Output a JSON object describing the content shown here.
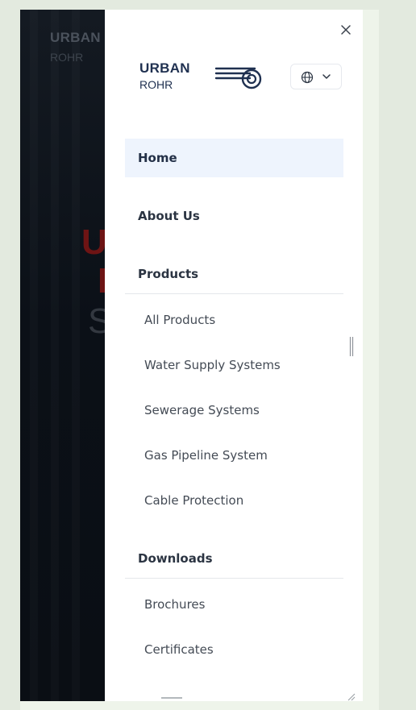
{
  "background": {
    "brand_name": "URBAN",
    "brand_sub": "ROHR",
    "hero_line1": "U",
    "hero_line2": "I",
    "hero_line3": "S"
  },
  "drawer": {
    "close_icon": "close-icon",
    "logo": {
      "line1": "URBAN",
      "line2": "ROHR",
      "mark_icon": "pipe-logo-icon"
    },
    "language_button": {
      "icon": "globe-icon",
      "dropdown_icon": "chevron-down-icon"
    },
    "nav": {
      "home": "Home",
      "about": "About Us",
      "products": {
        "label": "Products",
        "items": [
          "All Products",
          "Water Supply Systems",
          "Sewerage Systems",
          "Gas Pipeline System",
          "Cable Protection"
        ]
      },
      "downloads": {
        "label": "Downloads",
        "items": [
          "Brochures",
          "Certificates"
        ]
      }
    }
  },
  "colors": {
    "active_bg": "#eef4fd",
    "brand_navy": "#1f3050",
    "page_bg": "#e3eadf"
  }
}
